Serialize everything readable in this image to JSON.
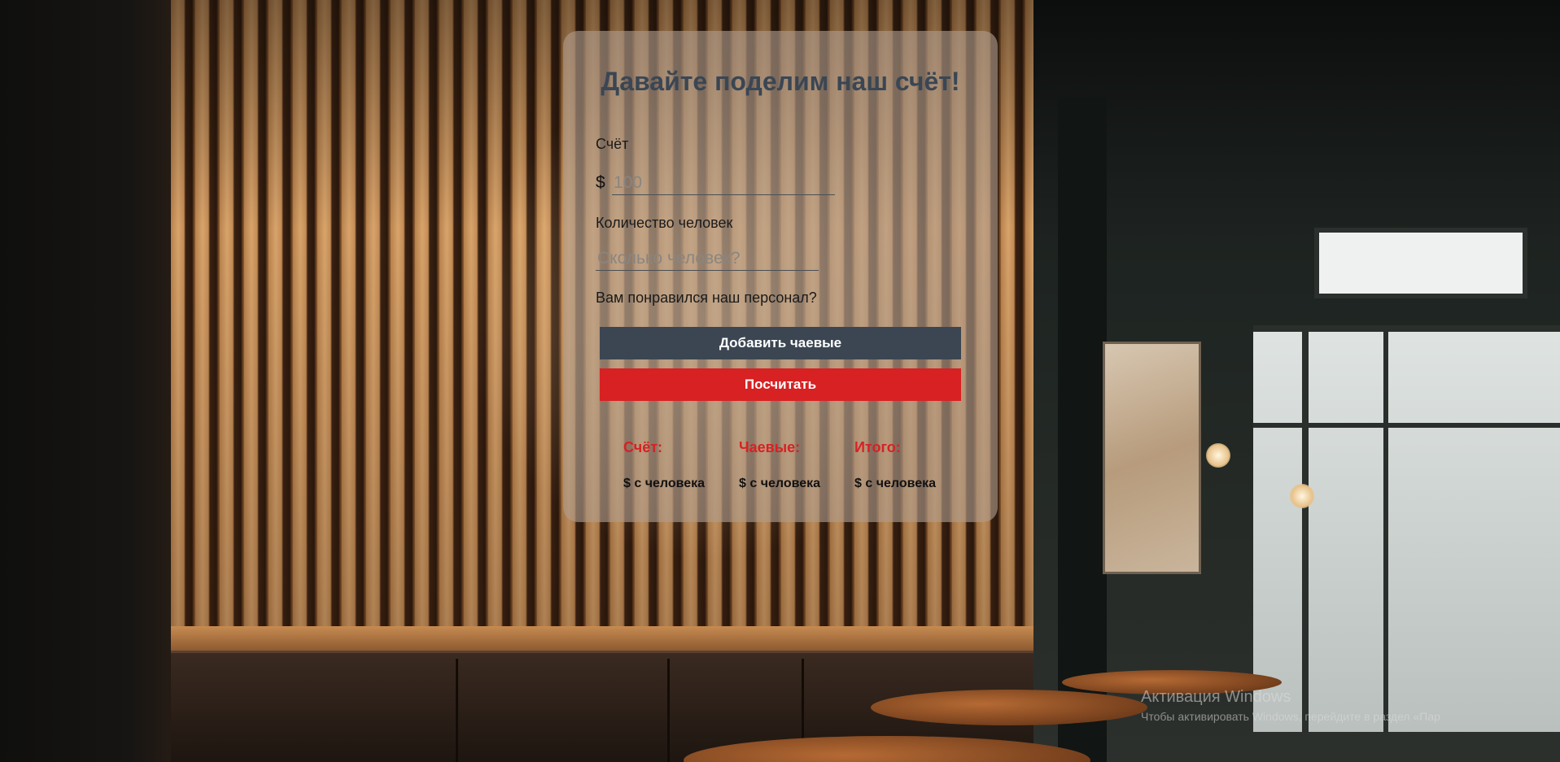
{
  "title": "Давайте поделим наш счёт!",
  "bill": {
    "label": "Счёт",
    "currency_symbol": "$",
    "placeholder": "100"
  },
  "people": {
    "label": "Количество человек",
    "placeholder": "Сколько человек?"
  },
  "tip_question": "Вам понравился наш персонал?",
  "buttons": {
    "add_tip": "Добавить чаевые",
    "calculate": "Посчитать"
  },
  "results": [
    {
      "heading": "Счёт:",
      "value": "$ с человека"
    },
    {
      "heading": "Чаевые:",
      "value": "$ с человека"
    },
    {
      "heading": "Итого:",
      "value": "$ с человека"
    }
  ],
  "windows_activation": {
    "title": "Активация Windows",
    "message": "Чтобы активировать Windows, перейдите в раздел «Пар"
  },
  "colors": {
    "title": "#3a4654",
    "add_tip_button": "#3b4652",
    "calculate_button": "#d72123",
    "result_heading": "#d72123"
  }
}
